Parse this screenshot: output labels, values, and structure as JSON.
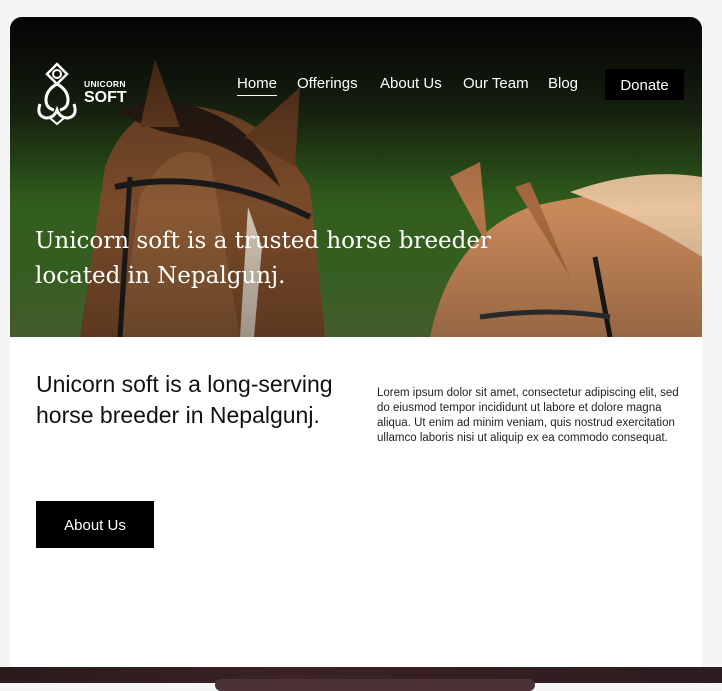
{
  "brand": {
    "top": "UNICORN",
    "bottom": "SOFT",
    "logo_icon": "meditating-figure-icon"
  },
  "nav": {
    "items": [
      {
        "label": "Home",
        "active": true
      },
      {
        "label": "Offerings",
        "active": false
      },
      {
        "label": "About Us",
        "active": false
      },
      {
        "label": "Our Team",
        "active": false
      },
      {
        "label": "Blog",
        "active": false
      }
    ],
    "donate_label": "Donate"
  },
  "hero": {
    "title": "Unicorn soft is a trusted horse breeder located in Nepalgunj."
  },
  "intro": {
    "title": "Unicorn soft is a long-serving horse breeder in Nepalgunj.",
    "body": "Lorem ipsum dolor sit amet, consectetur adipiscing elit, sed do eiusmod tempor incididunt ut labore et dolore magna aliqua. Ut enim ad minim veniam, quis nostrud exercitation ullamco laboris nisi ut aliquip ex ea commodo consequat.",
    "button_label": "About Us"
  },
  "colors": {
    "button_bg": "#000000",
    "text": "#111111",
    "hero_text": "#ffffff"
  }
}
